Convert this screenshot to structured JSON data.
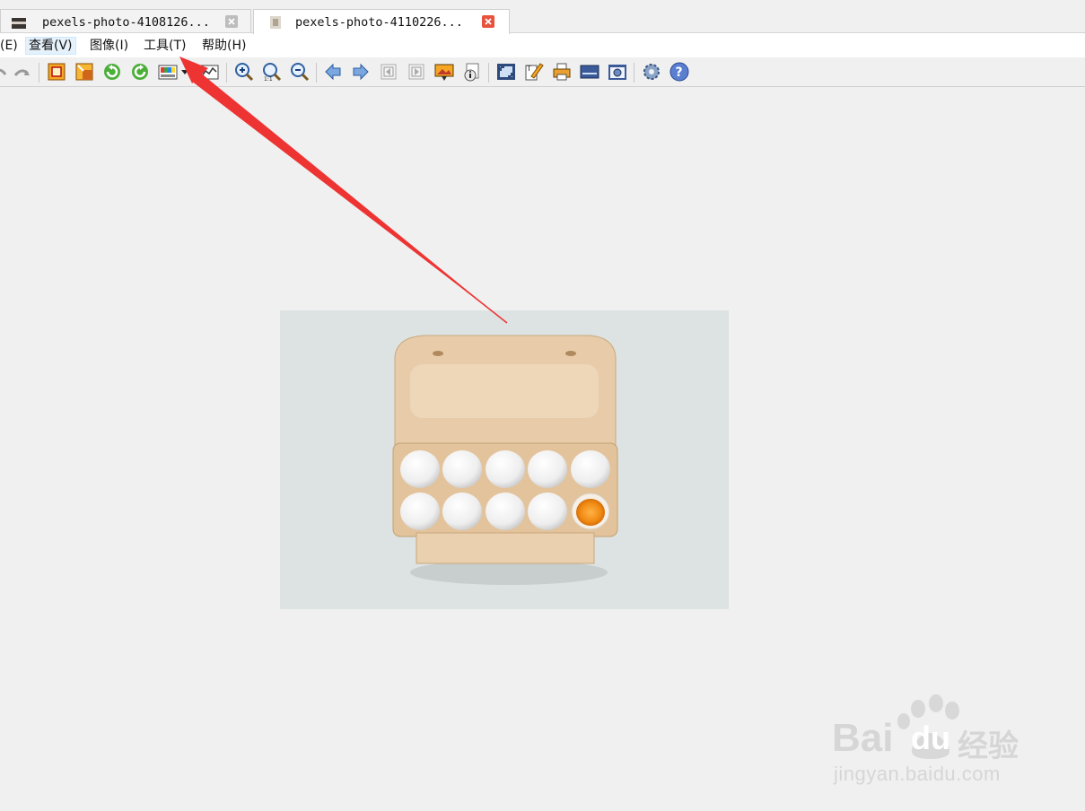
{
  "tabs": [
    {
      "title": "pexels-photo-4108126...",
      "active": false
    },
    {
      "title": "pexels-photo-4110226...",
      "active": true
    }
  ],
  "menu": {
    "edit": "(E)",
    "view": "查看(V)",
    "image": "图像(I)",
    "tools": "工具(T)",
    "help": "帮助(H)"
  },
  "toolbar_icons": [
    "redo-icon",
    "crop-icon",
    "resize-icon",
    "rotate-left-icon",
    "rotate-right-icon",
    "color-adjust-icon",
    "dropdown-icon",
    "histogram-icon",
    "zoom-in-icon",
    "zoom-actual-icon",
    "zoom-out-icon",
    "prev-icon",
    "next-icon",
    "first-page-icon",
    "last-page-icon",
    "slideshow-icon",
    "info-icon",
    "fullscreen-icon",
    "paint-icon",
    "print-icon",
    "scanner-icon",
    "screenshot-icon",
    "settings-icon",
    "help-icon"
  ],
  "watermark": {
    "brand": "Bai",
    "brand2": "du",
    "cn": "经验",
    "url": "jingyan.baidu.com"
  },
  "colors": {
    "accent_close": "#e8533d",
    "arrow": "#ee3333",
    "menu_hover": "#e5f1fb"
  }
}
